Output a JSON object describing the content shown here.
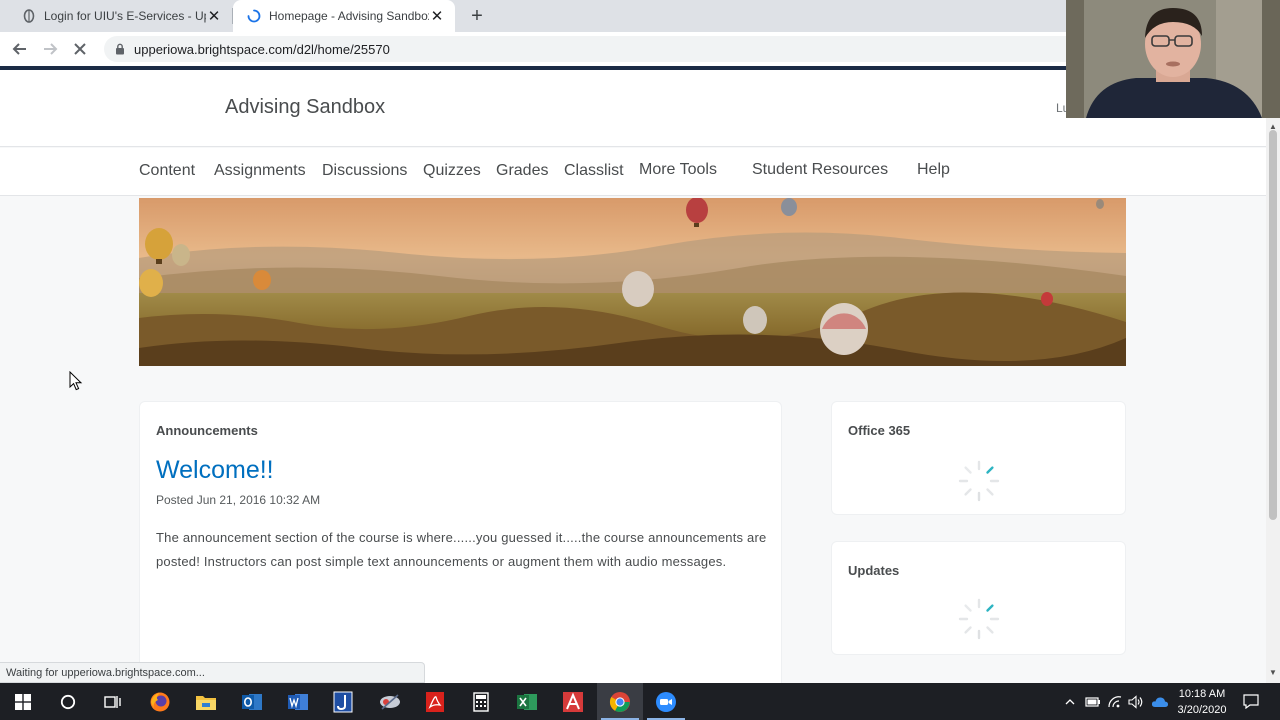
{
  "browser": {
    "tabs": [
      {
        "title": "Login for UIU's E-Services - Uppe",
        "close": "✕"
      },
      {
        "title": "Homepage - Advising Sandbox",
        "close": "✕"
      }
    ],
    "new_tab": "+",
    "url": "upperiowa.brightspace.com/d2l/home/25570"
  },
  "header": {
    "course_title": "Advising Sandbox",
    "user_initials": "Lu"
  },
  "navbar": {
    "items": [
      "Content",
      "Assignments",
      "Discussions",
      "Quizzes",
      "Grades",
      "Classlist",
      "More Tools",
      "Student Resources",
      "Help"
    ]
  },
  "announcements": {
    "heading": "Announcements",
    "title": "Welcome!!",
    "posted": "Posted Jun 21, 2016 10:32 AM",
    "body": "The announcement section of the course is where......you guessed it.....the course announcements are posted!  Instructors can post simple text announcements or augment them with audio messages."
  },
  "widgets": {
    "office365": {
      "title": "Office 365"
    },
    "updates": {
      "title": "Updates"
    }
  },
  "status_bar": {
    "text": "Waiting for upperiowa.brightspace.com..."
  },
  "taskbar": {
    "time": "10:18 AM",
    "date": "3/20/2020"
  },
  "colors": {
    "link_blue": "#006fbf",
    "navy_line": "#1b2b45",
    "spinner_teal": "#2db4c2"
  }
}
